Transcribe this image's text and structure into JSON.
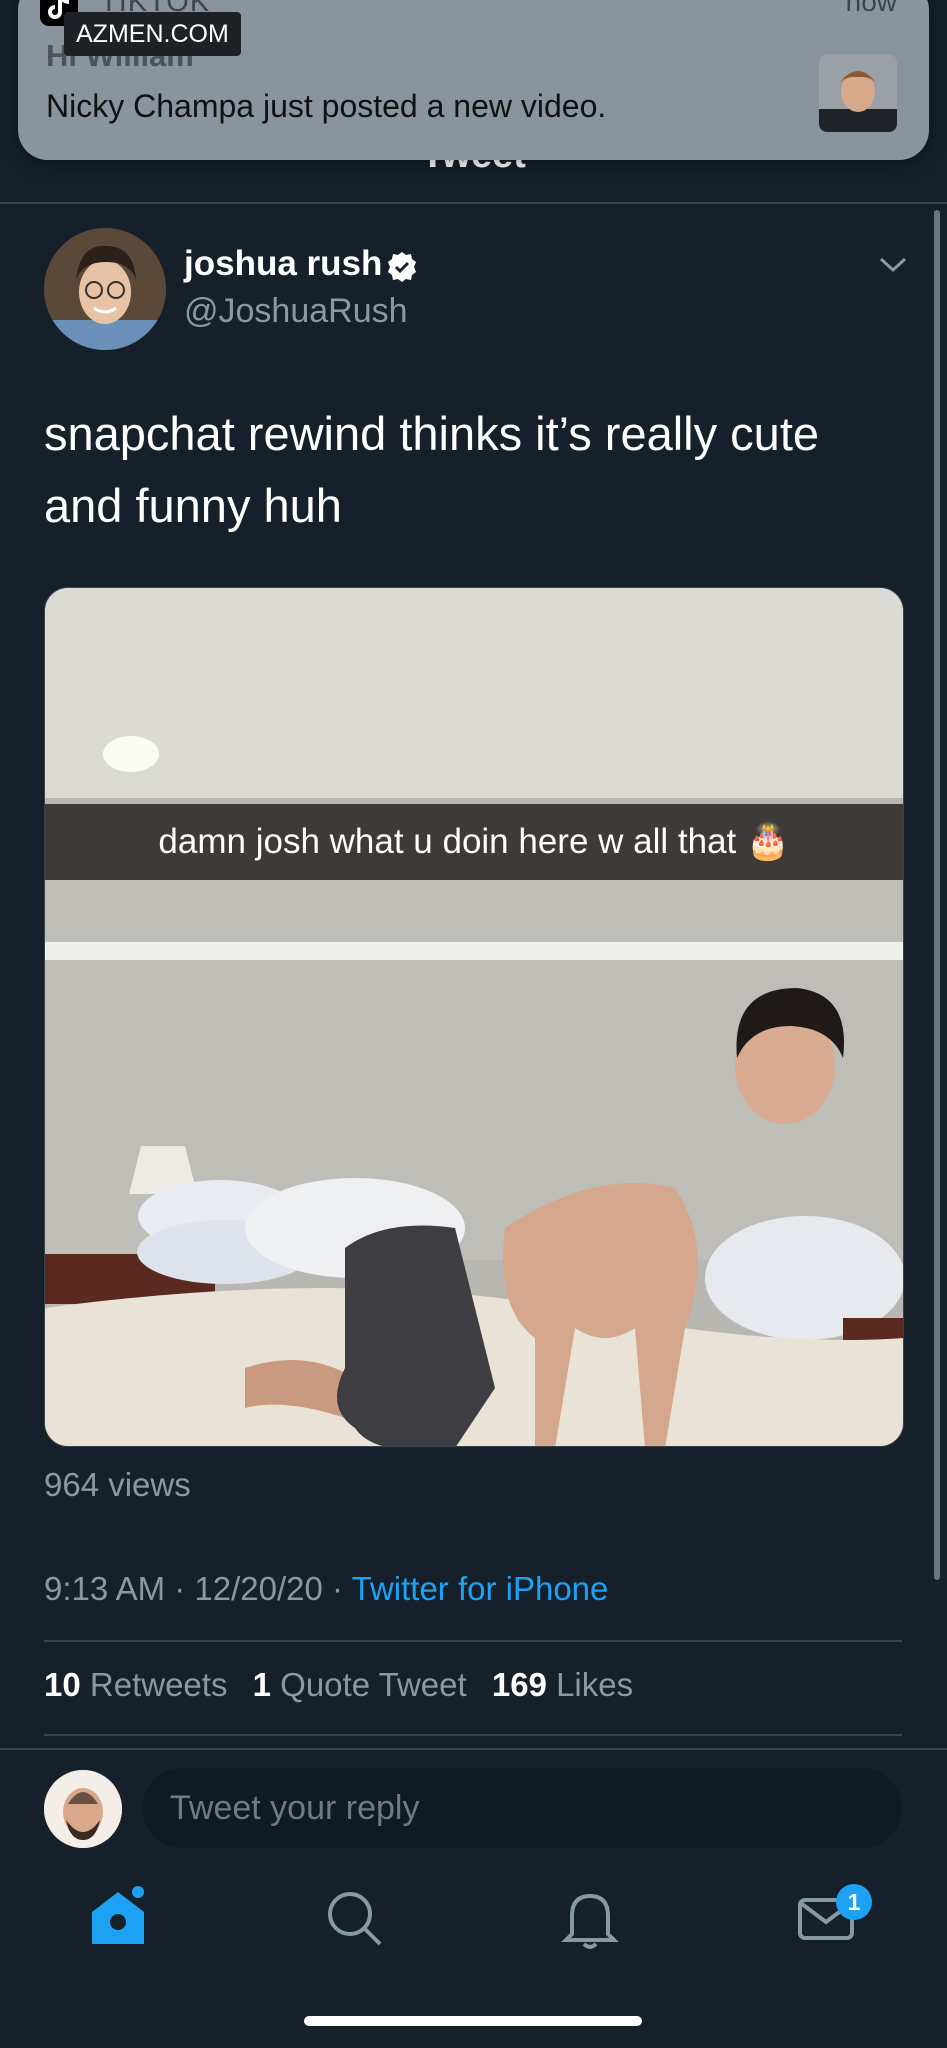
{
  "notification": {
    "app_name": "TIKTOK",
    "time": "now",
    "title": "Hi William",
    "body": "Nicky Champa just posted a new video.",
    "watermark": "AZMEN.COM"
  },
  "header": {
    "title": "Tweet"
  },
  "tweet": {
    "author_name": "joshua rush",
    "author_handle": "@JoshuaRush",
    "text": "snapchat rewind thinks it’s really cute and funny huh",
    "media_caption": "damn josh what u doin here w all that 🎂",
    "views": "964 views",
    "time": "9:13 AM",
    "date": "12/20/20",
    "separator": " · ",
    "source": "Twitter for iPhone",
    "stats": {
      "retweets_count": "10",
      "retweets_label": "Retweets",
      "quotes_count": "1",
      "quotes_label": "Quote Tweet",
      "likes_count": "169",
      "likes_label": "Likes"
    }
  },
  "reply": {
    "placeholder": "Tweet your reply"
  },
  "tabbar": {
    "items": [
      {
        "icon": "home-icon",
        "active": true
      },
      {
        "icon": "search-icon",
        "active": false
      },
      {
        "icon": "bell-icon",
        "active": false
      },
      {
        "icon": "mail-icon",
        "active": false
      }
    ],
    "messages_badge": "1"
  },
  "colors": {
    "background": "#15202b",
    "accent": "#1da1f2",
    "secondary_text": "#8899a6",
    "divider": "#38444d"
  }
}
